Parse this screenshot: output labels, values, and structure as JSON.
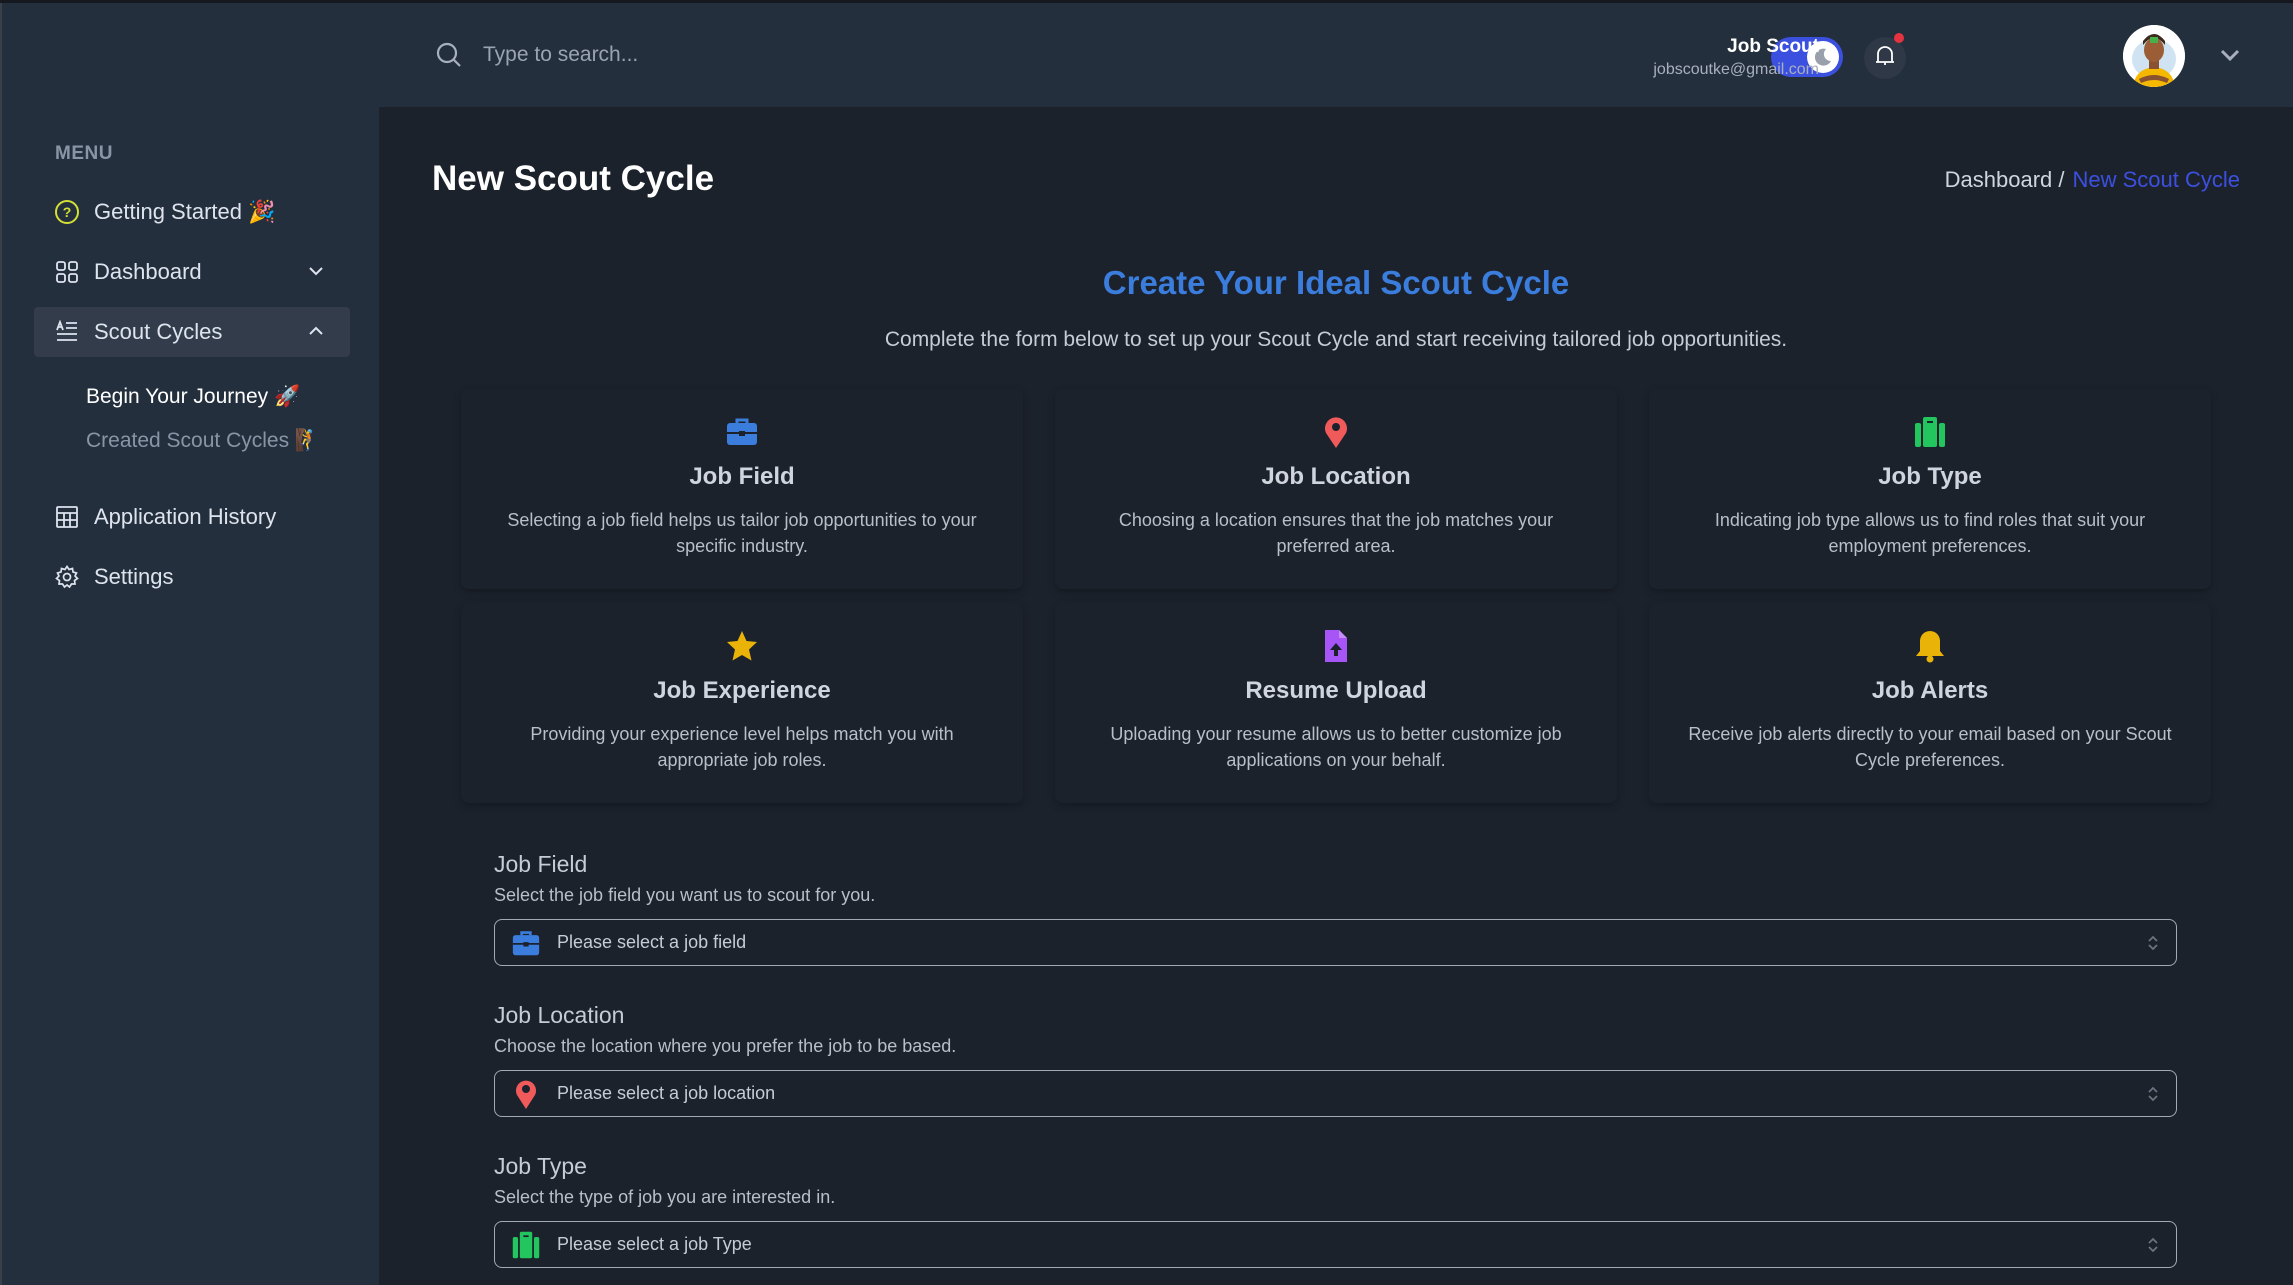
{
  "sidebar": {
    "menu_label": "MENU",
    "items": [
      {
        "label": "Getting Started 🎉",
        "icon": "question-circle-icon"
      },
      {
        "label": "Dashboard",
        "icon": "grid-icon",
        "expanded": false
      },
      {
        "label": "Scout Cycles",
        "icon": "list-icon",
        "expanded": true,
        "active": true
      },
      {
        "label": "Application History",
        "icon": "table-icon"
      },
      {
        "label": "Settings",
        "icon": "gear-icon"
      }
    ],
    "sub_items": [
      {
        "label": "Begin Your Journey 🚀",
        "current": true
      },
      {
        "label": "Created Scout Cycles 🧗",
        "current": false
      }
    ]
  },
  "header": {
    "search_placeholder": "Type to search...",
    "dark_mode": true,
    "notifications_unread": true,
    "user": {
      "name": "Job Scout",
      "email": "jobscoutke@gmail.com"
    }
  },
  "page": {
    "title": "New Scout Cycle",
    "breadcrumb": [
      {
        "label": "Dashboard /"
      },
      {
        "label": "New Scout Cycle"
      }
    ]
  },
  "hero": {
    "title": "Create Your Ideal Scout Cycle",
    "subtitle": "Complete the form below to set up your Scout Cycle and start receiving tailored job opportunities."
  },
  "features": [
    {
      "title": "Job Field",
      "desc": "Selecting a job field helps us tailor job opportunities to your specific industry.",
      "icon": "briefcase-icon",
      "color": "#3b7ddd"
    },
    {
      "title": "Job Location",
      "desc": "Choosing a location ensures that the job matches your preferred area.",
      "icon": "map-pin-icon",
      "color": "#f05a5a"
    },
    {
      "title": "Job Type",
      "desc": "Indicating job type allows us to find roles that suit your employment preferences.",
      "icon": "suitcase-icon",
      "color": "#22c55e"
    },
    {
      "title": "Job Experience",
      "desc": "Providing your experience level helps match you with appropriate job roles.",
      "icon": "star-icon",
      "color": "#eab308"
    },
    {
      "title": "Resume Upload",
      "desc": "Uploading your resume allows us to better customize job applications on your behalf.",
      "icon": "file-upload-icon",
      "color": "#a855f7"
    },
    {
      "title": "Job Alerts",
      "desc": "Receive job alerts directly to your email based on your Scout Cycle preferences.",
      "icon": "bell-icon",
      "color": "#eab308"
    }
  ],
  "form": {
    "fields": [
      {
        "label": "Job Field",
        "help": "Select the job field you want us to scout for you.",
        "placeholder": "Please select a job field",
        "icon": "briefcase-icon"
      },
      {
        "label": "Job Location",
        "help": "Choose the location where you prefer the job to be based.",
        "placeholder": "Please select a job location",
        "icon": "map-pin-icon"
      },
      {
        "label": "Job Type",
        "help": "Select the type of job you are interested in.",
        "placeholder": "Please select a job Type",
        "icon": "suitcase-icon"
      }
    ]
  },
  "colors": {
    "accent": "#3c50e0",
    "heading_blue": "#3b7ddd",
    "sidebar_bg": "#242f3e",
    "main_bg": "#1c222c"
  }
}
